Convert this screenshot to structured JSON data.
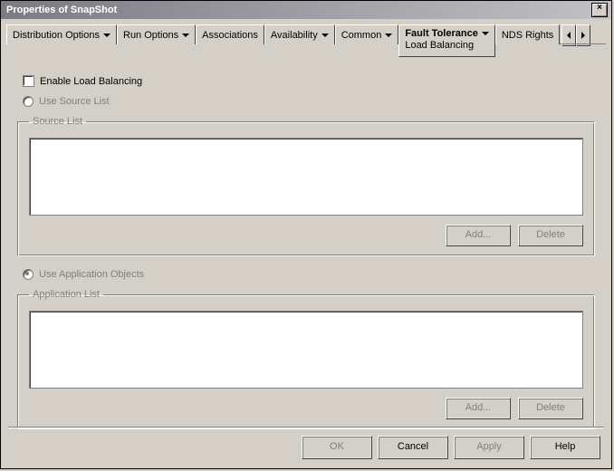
{
  "window": {
    "title": "Properties of SnapShot"
  },
  "tabs": [
    {
      "label": "Distribution Options",
      "hasDropdown": true
    },
    {
      "label": "Run Options",
      "hasDropdown": true
    },
    {
      "label": "Associations",
      "hasDropdown": false
    },
    {
      "label": "Availability",
      "hasDropdown": true
    },
    {
      "label": "Common",
      "hasDropdown": true
    },
    {
      "label": "Fault Tolerance",
      "hasDropdown": true,
      "active": true,
      "subLabel": "Load Balancing"
    },
    {
      "label": "NDS Rights",
      "hasDropdown": false
    }
  ],
  "page": {
    "enableLoadBalancingLabel": "Enable Load Balancing",
    "enableLoadBalancingChecked": false,
    "useSourceListLabel": "Use Source List",
    "useSourceListSelected": false,
    "sourceListLegend": "Source List",
    "useAppObjectsLabel": "Use Application Objects",
    "useAppObjectsSelected": true,
    "appListLegend": "Application List",
    "addLabel": "Add...",
    "deleteLabel": "Delete"
  },
  "dialog": {
    "ok": "OK",
    "cancel": "Cancel",
    "apply": "Apply",
    "help": "Help"
  }
}
